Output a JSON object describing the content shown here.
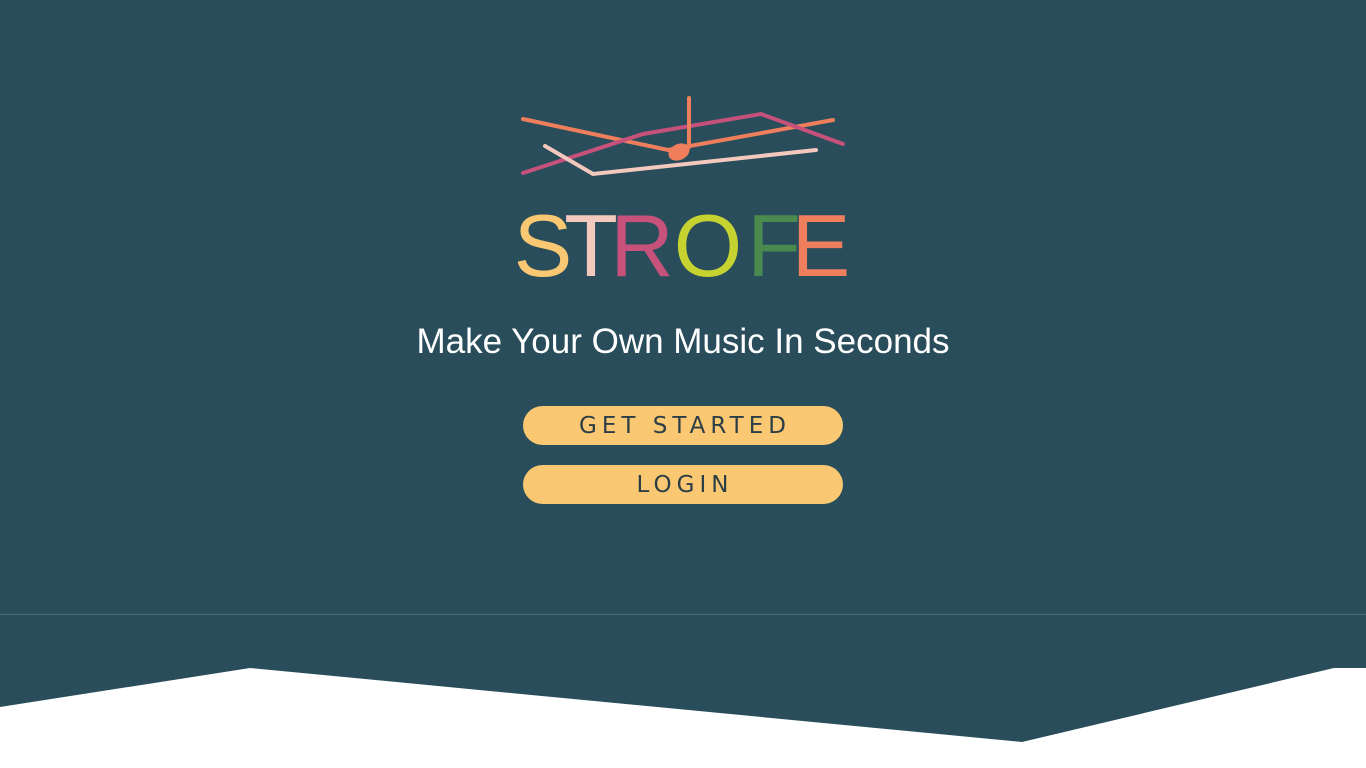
{
  "brand": {
    "name": "STROFE",
    "letters": [
      {
        "char": "S",
        "color": "#fac872"
      },
      {
        "char": "T",
        "color": "#f4c9bd"
      },
      {
        "char": "R",
        "color": "#c6517a"
      },
      {
        "char": "O",
        "color": "#c5d22f"
      },
      {
        "char": "F",
        "color": "#4a8a4f"
      },
      {
        "char": "E",
        "color": "#ef7f5c"
      }
    ],
    "logo_icon": "music-staff-note-icon"
  },
  "hero": {
    "tagline": "Make Your Own Music In Seconds",
    "get_started_label": "GET STARTED",
    "login_label": "LOGIN"
  },
  "colors": {
    "background": "#294d5b",
    "button": "#fac872",
    "button_text": "#2c3e45",
    "tagline": "#ffffff"
  }
}
